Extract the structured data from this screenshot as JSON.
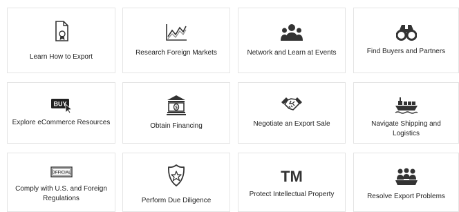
{
  "cards": [
    {
      "label": "Learn How to Export",
      "icon": "certificate-document-icon"
    },
    {
      "label": "Research Foreign Markets",
      "icon": "line-chart-icon"
    },
    {
      "label": "Network and Learn at Events",
      "icon": "people-group-icon"
    },
    {
      "label": "Find Buyers and Partners",
      "icon": "binoculars-icon"
    },
    {
      "label": "Explore eCommerce Resources",
      "icon": "buy-button-cursor-icon",
      "icon_text": "BUY"
    },
    {
      "label": "Obtain Financing",
      "icon": "bank-building-icon"
    },
    {
      "label": "Negotiate an Export Sale",
      "icon": "handshake-icon"
    },
    {
      "label": "Navigate Shipping and Logistics",
      "icon": "cargo-ship-icon"
    },
    {
      "label": "Comply with U.S. and Foreign Regulations",
      "icon": "official-stamp-icon",
      "icon_text": "OFFICIAL"
    },
    {
      "label": "Perform Due Diligence",
      "icon": "shield-star-icon"
    },
    {
      "label": "Protect Intellectual Property",
      "icon": "trademark-icon",
      "icon_text": "TM"
    },
    {
      "label": "Resolve Export Problems",
      "icon": "people-meeting-icon"
    }
  ],
  "colors": {
    "icon": "#333333",
    "text": "#222222",
    "border": "#e4e4e4",
    "background": "#ffffff"
  }
}
